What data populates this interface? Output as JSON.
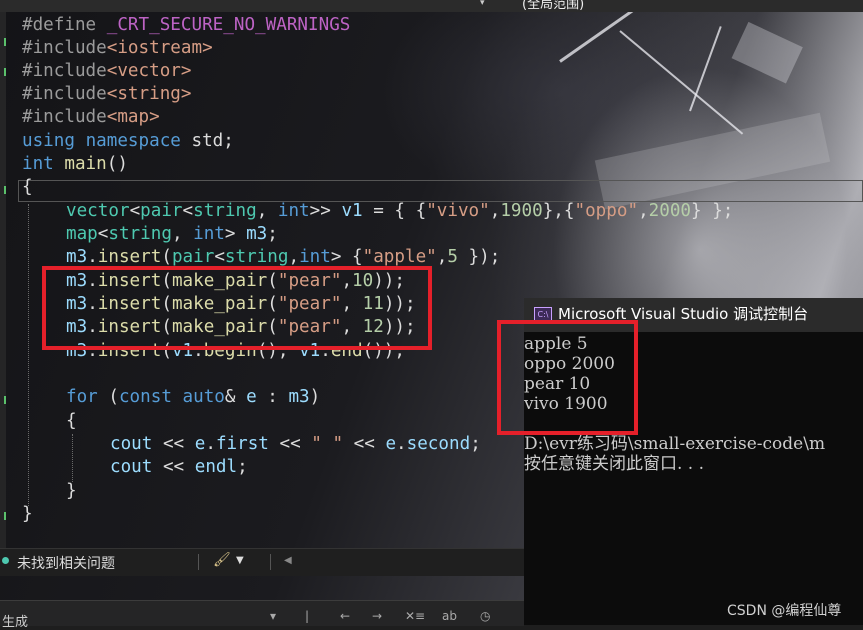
{
  "topbar": {
    "dropdown": "▾",
    "scope_label": "(全局范围)"
  },
  "code": {
    "lines": [
      "#define _CRT_SECURE_NO_WARNINGS",
      "#include<iostream>",
      "#include<vector>",
      "#include<string>",
      "#include<map>",
      "using namespace std;",
      "int main()",
      "{",
      "vector<pair<string, int>> v1 = { {\"vivo\",1900},{\"oppo\",2000} };",
      "map<string, int> m3;",
      "m3.insert(pair<string,int> {\"apple\",5 });",
      "m3.insert(make_pair(\"pear\",10));",
      "m3.insert(make_pair(\"pear\", 11));",
      "m3.insert(make_pair(\"pear\", 12));",
      "m3.insert(v1.begin(), v1.end());",
      "",
      "for (const auto& e : m3)",
      "{",
      "cout << e.first << \" \" << e.second;",
      "cout << endl;",
      "}",
      "}"
    ]
  },
  "console": {
    "title": "Microsoft Visual Studio 调试控制台",
    "icon": "vs-console-icon",
    "output": [
      "apple 5",
      "oppo 2000",
      "pear 10",
      "vivo 1900",
      "",
      "D:\\evr练习码\\small-exercise-code\\m",
      "按任意键关闭此窗口. . ."
    ]
  },
  "status": {
    "issues_text": "未找到相关问题",
    "brush_icon": "brush-icon"
  },
  "bottom": {
    "label": "生成"
  },
  "watermark": "CSDN @编程仙尊",
  "colors": {
    "highlight_box": "#e5202a",
    "keyword": "#569cd6",
    "type": "#4ec9b0",
    "string": "#d69d85",
    "macro": "#bd63c5"
  }
}
